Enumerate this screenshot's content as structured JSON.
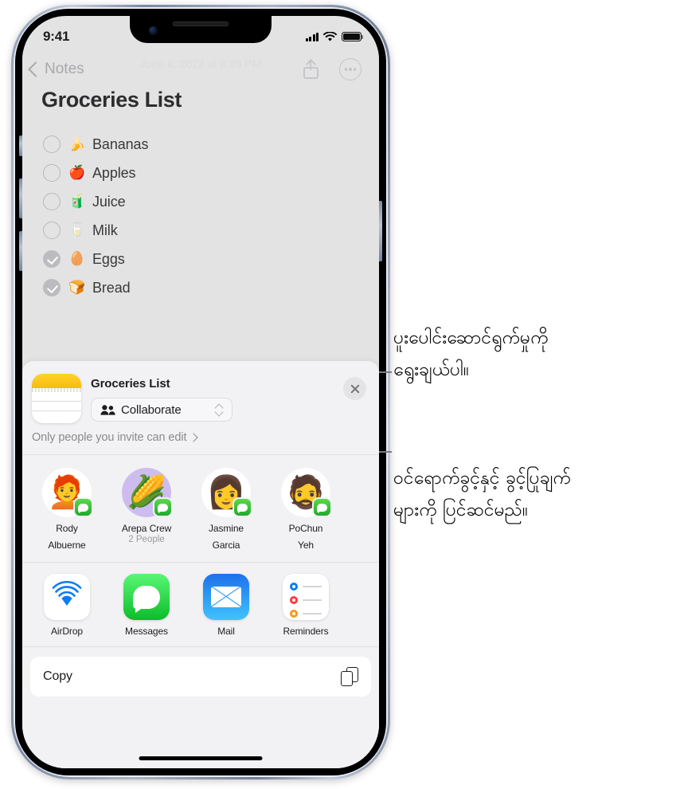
{
  "device": {
    "name": "iphone-frame",
    "status_bar": {
      "time": "9:41",
      "cellular_icon": "signal-bars-icon",
      "wifi_icon": "wifi-icon",
      "battery_icon": "battery-icon"
    }
  },
  "note_screen": {
    "nav": {
      "back_label": "Notes",
      "back_icon": "chevron-left-icon",
      "share_icon": "share-icon",
      "more_icon": "ellipsis-circle-icon"
    },
    "date_text": "June 8, 2022 at 8:39 PM",
    "title": "Groceries List",
    "checklist": [
      {
        "emoji": "🍌",
        "label": "Bananas",
        "checked": false
      },
      {
        "emoji": "🍎",
        "label": "Apples",
        "checked": false
      },
      {
        "emoji": "🧃",
        "label": "Juice",
        "checked": false
      },
      {
        "emoji": "🥛",
        "label": "Milk",
        "checked": false
      },
      {
        "emoji": "🥚",
        "label": "Eggs",
        "checked": true
      },
      {
        "emoji": "🍞",
        "label": "Bread",
        "checked": true
      }
    ]
  },
  "share_sheet": {
    "app_icon": "notes-app-icon",
    "title": "Groceries List",
    "collaborate": {
      "label": "Collaborate",
      "people_icon": "people-icon",
      "chevron_icon": "up-down-chevron-icon"
    },
    "permission": {
      "text": "Only people you invite can edit",
      "chevron_icon": "chevron-right-icon"
    },
    "close_icon": "close-x-icon",
    "contacts": [
      {
        "name": "Rody",
        "name2": "Albuerne",
        "sub": "",
        "emoji": "🧑‍🦰",
        "bg": "white",
        "badge": "messages-badge-icon"
      },
      {
        "name": "Arepa Crew",
        "name2": "",
        "sub": "2 People",
        "emoji": "🌽",
        "bg": "purple",
        "badge": "messages-badge-icon"
      },
      {
        "name": "Jasmine",
        "name2": "Garcia",
        "sub": "",
        "emoji": "👩",
        "bg": "white",
        "badge": "messages-badge-icon"
      },
      {
        "name": "PoChun",
        "name2": "Yeh",
        "sub": "",
        "emoji": "🧔",
        "bg": "white",
        "badge": "messages-badge-icon"
      }
    ],
    "apps": [
      {
        "name": "AirDrop",
        "icon": "airdrop-icon"
      },
      {
        "name": "Messages",
        "icon": "messages-icon"
      },
      {
        "name": "Mail",
        "icon": "mail-icon"
      },
      {
        "name": "Reminders",
        "icon": "reminders-icon"
      }
    ],
    "actions": [
      {
        "label": "Copy",
        "icon": "copy-icon"
      }
    ]
  },
  "annotations": [
    {
      "id": "callout1",
      "line1": "ပူးပေါင်းဆောင်ရွက်မှုကို",
      "line2": "ရွေးချယ်ပါ။"
    },
    {
      "id": "callout2",
      "line1": "ဝင်ရောက်ခွင့်နှင့် ခွင့်ပြုချက်",
      "line2": "များကို ပြင်ဆင်မည်။"
    }
  ],
  "colors": {
    "screen_bg": "#e3e3e3",
    "sheet_bg": "#f2f2f4",
    "accent_green": "#1faa2b",
    "accent_blue": "#0a7cf5",
    "notes_yellow": "#ffd426"
  }
}
